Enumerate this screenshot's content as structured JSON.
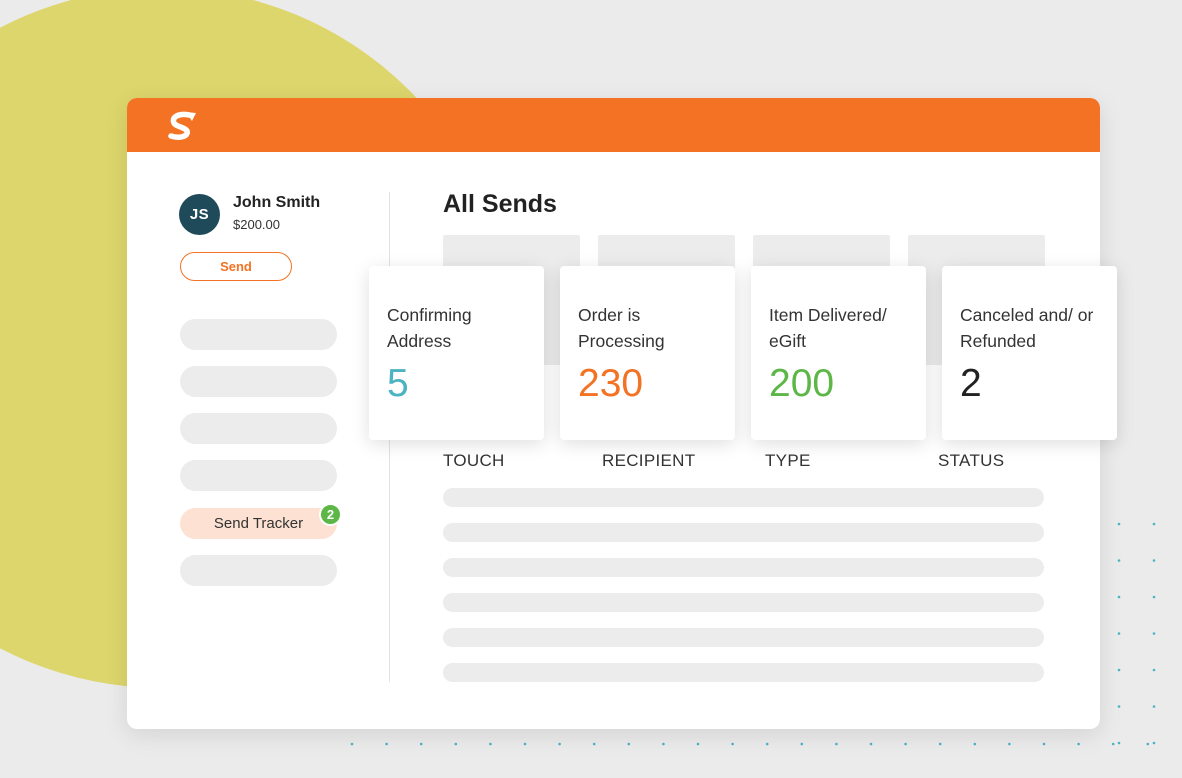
{
  "user": {
    "initials": "JS",
    "name": "John Smith",
    "balance": "$200.00"
  },
  "sidebar": {
    "send_label": "Send",
    "active_item": {
      "label": "Send Tracker",
      "badge_count": "2"
    }
  },
  "main": {
    "title": "All Sends",
    "columns": [
      "TOUCH",
      "RECIPIENT",
      "TYPE",
      "STATUS"
    ]
  },
  "status_cards": [
    {
      "label": "Confirming Address",
      "value": "5",
      "color": "#4cb3c3"
    },
    {
      "label": "Order is Processing",
      "value": "230",
      "color": "#f37224"
    },
    {
      "label": "Item Delivered/ eGift",
      "value": "200",
      "color": "#5cb747"
    },
    {
      "label": "Canceled and/ or Refunded",
      "value": "2",
      "color": "#222222"
    }
  ],
  "colors": {
    "brand": "#f37224",
    "background_blob": "#ddd66c",
    "avatar": "#1f4a5a",
    "dots": "#4cb3c3"
  },
  "icons": {
    "logo": "brand-logo-icon"
  }
}
